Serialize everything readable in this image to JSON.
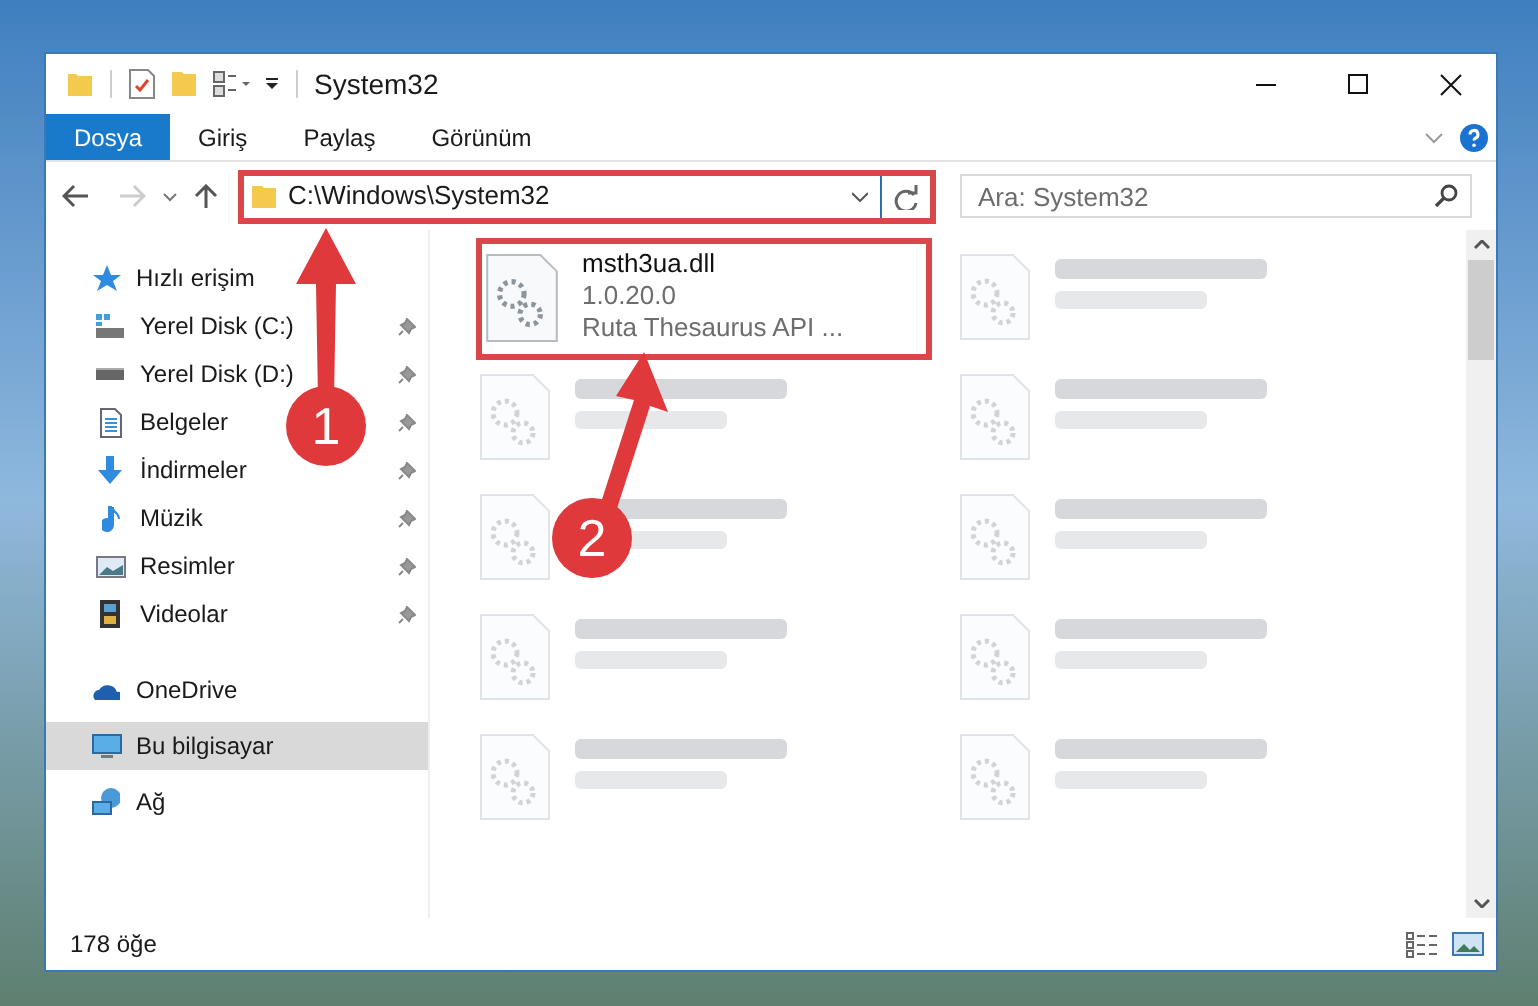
{
  "window": {
    "title": "System32"
  },
  "ribbon_tabs": [
    {
      "label": "Dosya",
      "selected": true
    },
    {
      "label": "Giriş",
      "selected": false
    },
    {
      "label": "Paylaş",
      "selected": false
    },
    {
      "label": "Görünüm",
      "selected": false
    }
  ],
  "address_bar": {
    "value": "C:\\Windows\\System32"
  },
  "search": {
    "placeholder": "Ara: System32"
  },
  "sidebar": {
    "items": [
      {
        "label": "Hızlı erişim",
        "kind": "star",
        "selected": false,
        "children": [
          {
            "label": "Yerel Disk (C:)",
            "kind": "drive-windows",
            "pinned": true,
            "selected": false
          },
          {
            "label": "Yerel Disk (D:)",
            "kind": "drive",
            "pinned": true,
            "selected": false
          },
          {
            "label": "Belgeler",
            "kind": "documents",
            "pinned": true,
            "selected": false
          },
          {
            "label": "İndirmeler",
            "kind": "download",
            "pinned": true,
            "selected": false
          },
          {
            "label": "Müzik",
            "kind": "music",
            "pinned": true,
            "selected": false
          },
          {
            "label": "Resimler",
            "kind": "pictures",
            "pinned": true,
            "selected": false
          },
          {
            "label": "Videolar",
            "kind": "videos",
            "pinned": true,
            "selected": false
          }
        ]
      },
      {
        "label": "OneDrive",
        "kind": "cloud",
        "selected": false
      },
      {
        "label": "Bu bilgisayar",
        "kind": "computer",
        "selected": true
      },
      {
        "label": "Ağ",
        "kind": "network",
        "selected": false
      }
    ]
  },
  "files": [
    {
      "kind": "file",
      "name": "msth3ua.dll",
      "lines": [
        "1.0.20.0",
        "Ruta Thesaurus API ..."
      ],
      "highlighted": true
    },
    {
      "kind": "blurred"
    },
    {
      "kind": "blurred"
    },
    {
      "kind": "blurred"
    },
    {
      "kind": "blurred"
    },
    {
      "kind": "blurred"
    },
    {
      "kind": "blurred"
    },
    {
      "kind": "blurred"
    },
    {
      "kind": "blurred"
    },
    {
      "kind": "blurred"
    }
  ],
  "status_bar": {
    "count": "178 öğe"
  },
  "annotations": [
    {
      "number": "1"
    },
    {
      "number": "2"
    }
  ]
}
